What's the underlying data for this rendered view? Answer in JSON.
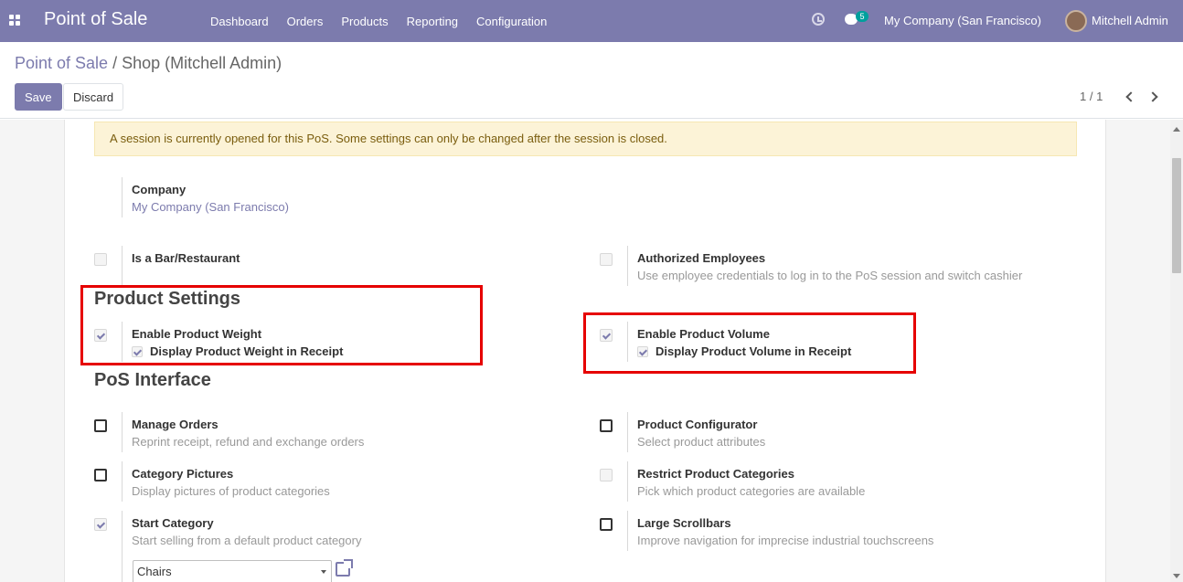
{
  "nav": {
    "brand": "Point of Sale",
    "menu": [
      "Dashboard",
      "Orders",
      "Products",
      "Reporting",
      "Configuration"
    ],
    "chat_count": "5",
    "company": "My Company (San Francisco)",
    "user": "Mitchell Admin"
  },
  "control_panel": {
    "breadcrumb_root": "Point of Sale",
    "breadcrumb_sep": "/",
    "breadcrumb_current": "Shop (Mitchell Admin)",
    "save_label": "Save",
    "discard_label": "Discard",
    "pager": "1 / 1"
  },
  "alert": "A session is currently opened for this PoS. Some settings can only be changed after the session is closed.",
  "company_field": {
    "label": "Company",
    "value": "My Company (San Francisco)"
  },
  "bar": {
    "label": "Is a Bar/Restaurant"
  },
  "employees": {
    "label": "Authorized Employees",
    "help": "Use employee credentials to log in to the PoS session and switch cashier"
  },
  "product_settings": {
    "heading": "Product Settings",
    "weight_label": "Enable Product Weight",
    "weight_receipt": "Display Product Weight in Receipt",
    "volume_label": "Enable Product Volume",
    "volume_receipt": "Display Product Volume in Receipt"
  },
  "pos_interface": {
    "heading": "PoS Interface",
    "manage_orders": {
      "label": "Manage Orders",
      "help": "Reprint receipt, refund and exchange orders"
    },
    "configurator": {
      "label": "Product Configurator",
      "help": "Select product attributes"
    },
    "category_pictures": {
      "label": "Category Pictures",
      "help": "Display pictures of product categories"
    },
    "restrict_categories": {
      "label": "Restrict Product Categories",
      "help": "Pick which product categories are available"
    },
    "start_category": {
      "label": "Start Category",
      "help": "Start selling from a default product category",
      "value": "Chairs"
    },
    "large_scrollbars": {
      "label": "Large Scrollbars",
      "help": "Improve navigation for imprecise industrial touchscreens"
    }
  },
  "colors": {
    "brand": "#7c7bad",
    "highlight": "#e60000",
    "alert_bg": "#fcf3d7"
  }
}
